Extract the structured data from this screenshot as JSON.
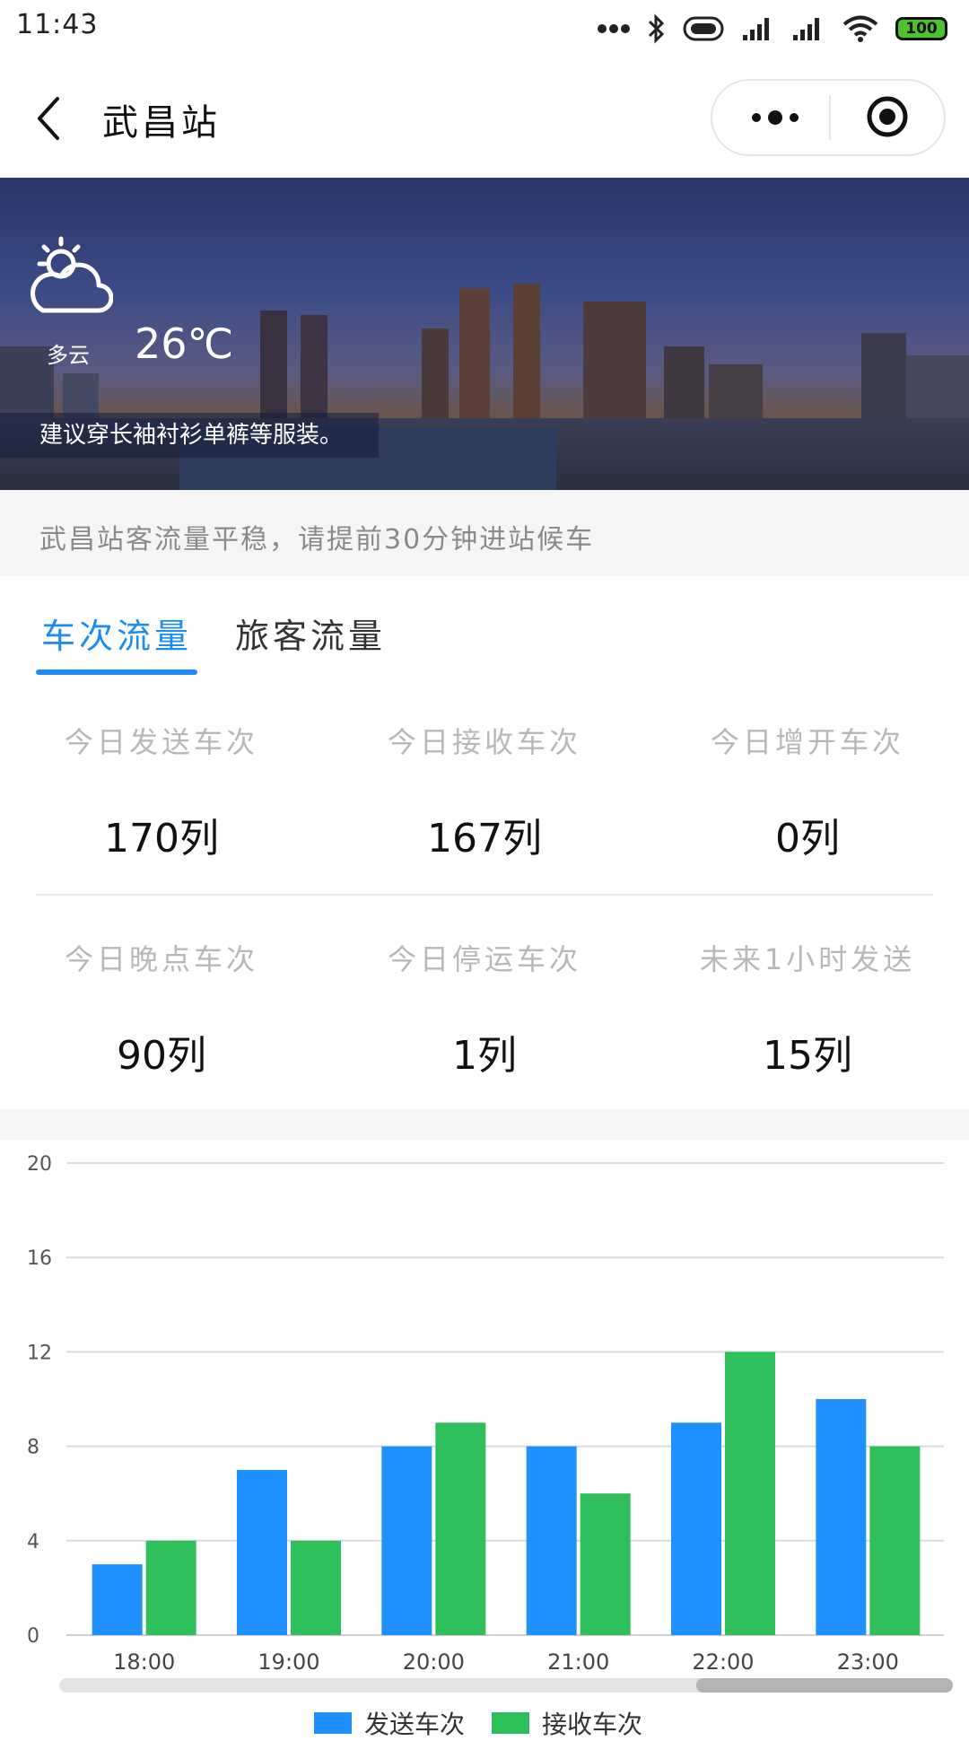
{
  "status_bar": {
    "time": "11:43",
    "battery": "100"
  },
  "nav": {
    "title": "武昌站"
  },
  "weather": {
    "condition": "多云",
    "temperature": "26℃",
    "advice": "建议穿长袖衬衫单裤等服装。"
  },
  "notice": "武昌站客流量平稳，请提前30分钟进站候车",
  "tabs": [
    {
      "label": "车次流量",
      "active": true
    },
    {
      "label": "旅客流量",
      "active": false
    }
  ],
  "stats": [
    {
      "label": "今日发送车次",
      "value": "170列"
    },
    {
      "label": "今日接收车次",
      "value": "167列"
    },
    {
      "label": "今日增开车次",
      "value": "0列"
    },
    {
      "label": "今日晚点车次",
      "value": "90列"
    },
    {
      "label": "今日停运车次",
      "value": "1列"
    },
    {
      "label": "未来1小时发送",
      "value": "15列"
    }
  ],
  "colors": {
    "accent": "#1d8cf0",
    "send": "#1e90ff",
    "receive": "#2fbf5a"
  },
  "chart_data": {
    "type": "bar",
    "categories": [
      "18:00",
      "19:00",
      "20:00",
      "21:00",
      "22:00",
      "23:00"
    ],
    "series": [
      {
        "name": "发送车次",
        "values": [
          3,
          7,
          8,
          8,
          9,
          10
        ]
      },
      {
        "name": "接收车次",
        "values": [
          4,
          4,
          9,
          6,
          12,
          8
        ]
      }
    ],
    "yticks": [
      "0",
      "4",
      "8",
      "12",
      "16",
      "20"
    ],
    "ylim": [
      0,
      20
    ],
    "grid": true,
    "legend": "bottom-center"
  }
}
